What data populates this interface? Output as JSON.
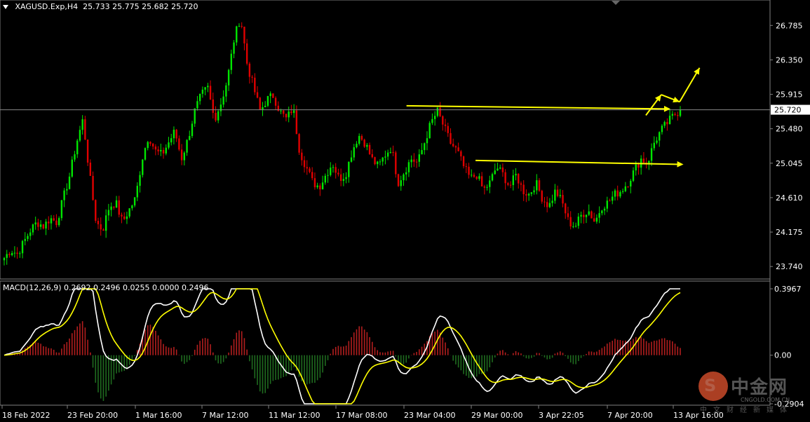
{
  "header": {
    "symbol": "XAGUSD.Exp,H4",
    "ohlc": "25.733 25.775 25.682 25.720"
  },
  "macd_header": "MACD(12,26,9) 0.2692 0.2496 0.0255 0.0000 0.2496",
  "colors": {
    "background": "#000000",
    "bull": "#00e600",
    "bear": "#e00000",
    "histogram_up": "#b21e1e",
    "histogram_down": "#1f6b1f",
    "macd_line": "#ffffff",
    "signal_line": "#ffff00",
    "annotation": "#ffff00",
    "current_price_line": "#888888"
  },
  "chart_data": [
    {
      "type": "candlestick",
      "symbol": "XAGUSD.Exp",
      "timeframe": "H4",
      "y_ticks": [
        "26.785",
        "26.350",
        "25.915",
        "25.480",
        "25.045",
        "24.610",
        "24.175",
        "23.740"
      ],
      "ylim": [
        23.6,
        27.0
      ],
      "current_price": "25.720",
      "x_ticks": [
        "18 Feb 2022",
        "23 Feb 20:00",
        "1 Mar 16:00",
        "7 Mar 12:00",
        "11 Mar 12:00",
        "17 Mar 08:00",
        "23 Mar 04:00",
        "29 Mar 00:00",
        "3 Apr 22:05",
        "7 Apr 20:00",
        "13 Apr 16:00"
      ],
      "close_path": [
        23.85,
        23.95,
        23.9,
        24.05,
        24.2,
        24.3,
        24.25,
        24.35,
        24.3,
        24.6,
        24.9,
        25.3,
        25.6,
        24.9,
        24.3,
        24.2,
        24.5,
        24.55,
        24.3,
        24.45,
        24.6,
        25.1,
        25.4,
        25.2,
        25.15,
        25.3,
        25.45,
        25.1,
        25.35,
        25.7,
        25.9,
        26.0,
        25.6,
        25.8,
        26.1,
        26.6,
        26.9,
        26.3,
        26.0,
        25.7,
        25.85,
        25.9,
        25.7,
        25.6,
        25.75,
        25.2,
        25.0,
        24.8,
        24.75,
        24.9,
        25.05,
        24.85,
        24.9,
        25.2,
        25.4,
        25.3,
        25.1,
        25.0,
        25.15,
        25.25,
        24.8,
        24.95,
        25.1,
        25.05,
        25.3,
        25.55,
        25.7,
        25.5,
        25.3,
        25.2,
        25.0,
        24.85,
        24.9,
        24.7,
        24.8,
        25.0,
        24.9,
        24.75,
        24.9,
        24.7,
        24.65,
        24.8,
        24.6,
        24.5,
        24.7,
        24.55,
        24.3,
        24.25,
        24.4,
        24.45,
        24.3,
        24.5,
        24.55,
        24.65,
        24.7,
        24.8,
        24.95,
        25.1,
        25.05,
        25.3,
        25.45,
        25.55,
        25.65,
        25.72
      ],
      "annotations": [
        {
          "type": "horizontal-arrow",
          "from": [
            0.528,
            25.77
          ],
          "to": [
            0.872,
            25.73
          ]
        },
        {
          "type": "horizontal-arrow",
          "from": [
            0.618,
            25.08
          ],
          "to": [
            0.889,
            25.03
          ]
        },
        {
          "type": "projection-path",
          "points": [
            [
              0.84,
              25.65
            ],
            [
              0.86,
              25.91
            ],
            [
              0.884,
              25.82
            ],
            [
              0.91,
              26.25
            ]
          ]
        }
      ]
    },
    {
      "type": "macd",
      "params": "MACD(12,26,9)",
      "values": {
        "macd": 0.2692,
        "signal": 0.2496,
        "histogram": 0.0255,
        "aux": 0.0
      },
      "y_ticks": [
        "0.3967",
        "0.00",
        "-0.2904"
      ],
      "ylim": [
        -0.2904,
        0.3967
      ]
    }
  ],
  "watermark": {
    "name": "中金网",
    "domain": "CNGOLD.COM.CN",
    "tagline": "中文财经新媒体"
  }
}
